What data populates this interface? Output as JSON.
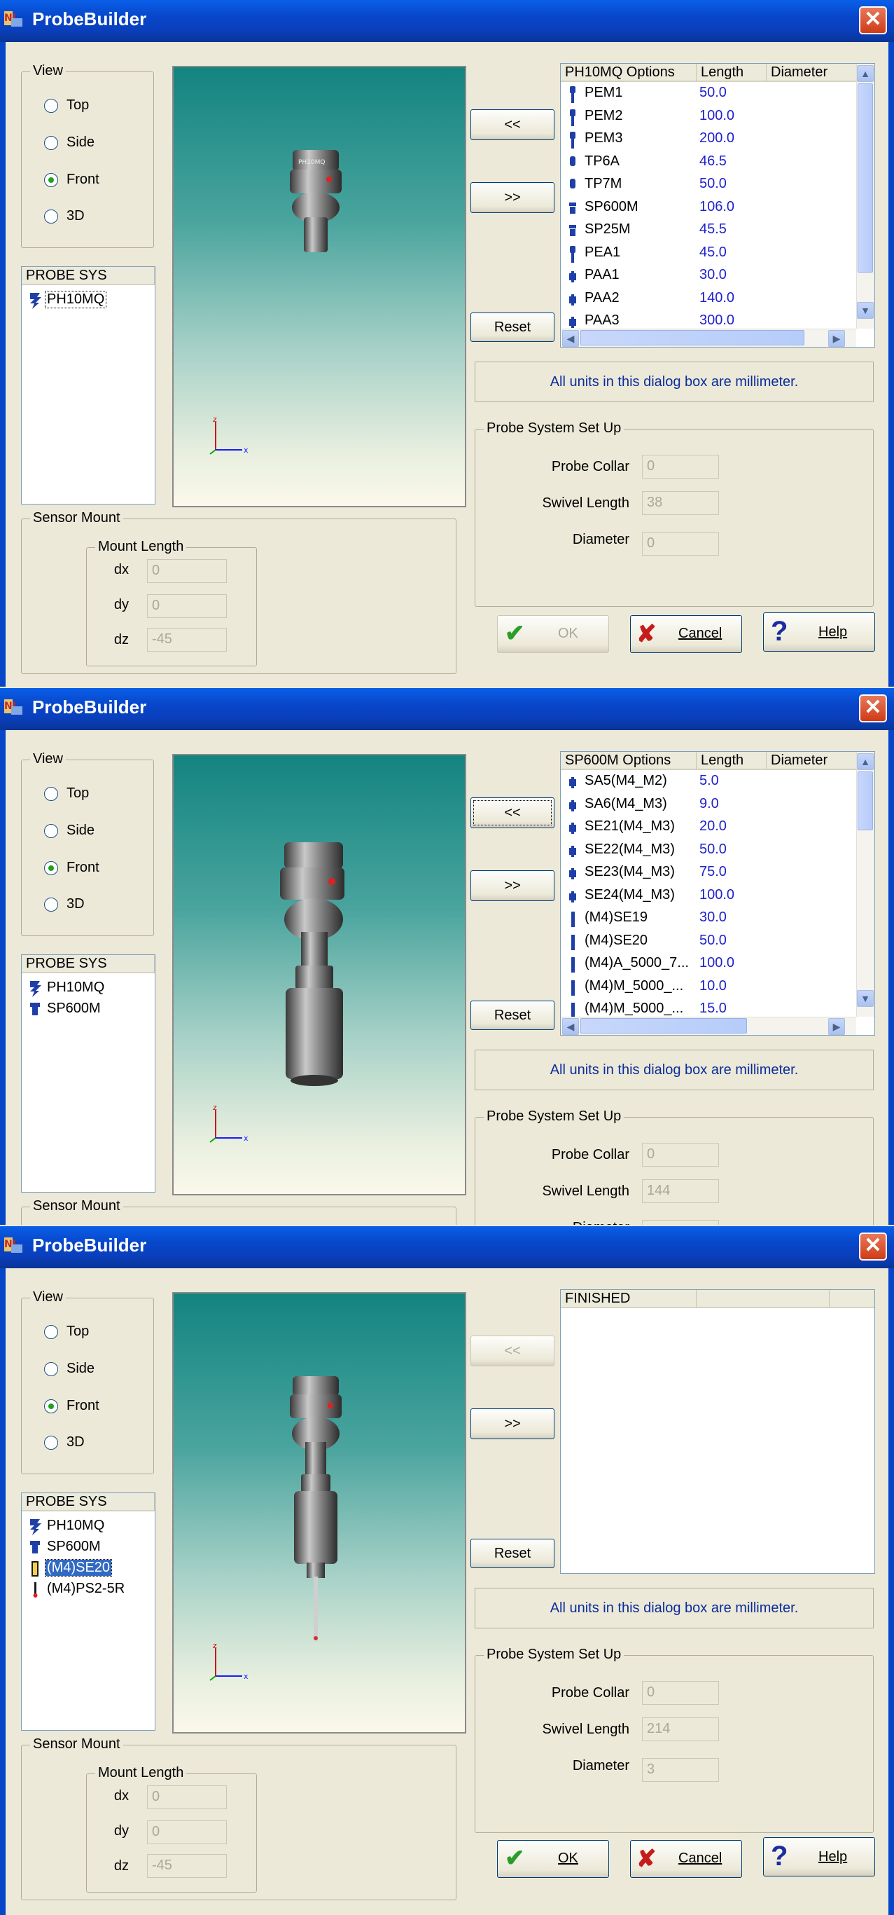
{
  "app": {
    "title": "ProbeBuilder",
    "close_glyph": "✕"
  },
  "colors": {
    "titlebar": "#0a46c8",
    "value_text": "#2020d0",
    "info_text": "#0b2d9b",
    "selection": "#316ac5"
  },
  "common": {
    "view_group": "View",
    "view_options": [
      "Top",
      "Side",
      "Front",
      "3D"
    ],
    "probe_sys_header": "PROBE SYS",
    "sensor_mount": "Sensor Mount",
    "mount_length": "Mount Length",
    "dx_label": "dx",
    "dy_label": "dy",
    "dz_label": "dz",
    "add_button": "<<",
    "remove_button": ">>",
    "reset_button": "Reset",
    "units_info": "All units in this dialog box are millimeter.",
    "setup_group": "Probe System Set Up",
    "probe_collar_label": "Probe Collar",
    "swivel_length_label": "Swivel Length",
    "diameter_label": "Diameter",
    "length_header": "Length",
    "diameter_header": "Diameter",
    "ok_label": "OK",
    "cancel_label": "Cancel",
    "help_label": "Help",
    "axis_x": "x",
    "axis_z": "z"
  },
  "windows": [
    {
      "selected_view": "Front",
      "probe_sys": [
        {
          "name": "PH10MQ",
          "icon": "ph10mq-icon"
        }
      ],
      "options_header": "PH10MQ Options",
      "options": [
        {
          "name": "PEM1",
          "length": "50.0",
          "icon": "extension-icon"
        },
        {
          "name": "PEM2",
          "length": "100.0",
          "icon": "extension-icon"
        },
        {
          "name": "PEM3",
          "length": "200.0",
          "icon": "extension-icon"
        },
        {
          "name": "TP6A",
          "length": "46.5",
          "icon": "probe-icon"
        },
        {
          "name": "TP7M",
          "length": "50.0",
          "icon": "probe-icon"
        },
        {
          "name": "SP600M",
          "length": "106.0",
          "icon": "probe-body-icon"
        },
        {
          "name": "SP25M",
          "length": "45.5",
          "icon": "probe-body-icon"
        },
        {
          "name": "PEA1",
          "length": "45.0",
          "icon": "extension-icon"
        },
        {
          "name": "PAA1",
          "length": "30.0",
          "icon": "adapter-icon"
        },
        {
          "name": "PAA2",
          "length": "140.0",
          "icon": "adapter-icon"
        },
        {
          "name": "PAA3",
          "length": "300.0",
          "icon": "adapter-icon"
        }
      ],
      "probe_collar": "0",
      "swivel_length": "38",
      "diameter": "0",
      "dx": "0",
      "dy": "0",
      "dz": "-45",
      "ok_enabled": false
    },
    {
      "selected_view": "Front",
      "probe_sys": [
        {
          "name": "PH10MQ",
          "icon": "ph10mq-icon"
        },
        {
          "name": "SP600M",
          "icon": "probe-body-icon"
        }
      ],
      "options_header": "SP600M Options",
      "options": [
        {
          "name": "SA5(M4_M2)",
          "length": "5.0",
          "icon": "adapter-icon"
        },
        {
          "name": "SA6(M4_M3)",
          "length": "9.0",
          "icon": "adapter-icon"
        },
        {
          "name": "SE21(M4_M3)",
          "length": "20.0",
          "icon": "adapter-icon"
        },
        {
          "name": "SE22(M4_M3)",
          "length": "50.0",
          "icon": "adapter-icon"
        },
        {
          "name": "SE23(M4_M3)",
          "length": "75.0",
          "icon": "adapter-icon"
        },
        {
          "name": "SE24(M4_M3)",
          "length": "100.0",
          "icon": "adapter-icon"
        },
        {
          "name": "(M4)SE19",
          "length": "30.0",
          "icon": "stylus-icon"
        },
        {
          "name": "(M4)SE20",
          "length": "50.0",
          "icon": "stylus-icon"
        },
        {
          "name": "(M4)A_5000_7...",
          "length": "100.0",
          "icon": "stylus-icon"
        },
        {
          "name": "(M4)M_5000_...",
          "length": "10.0",
          "icon": "stylus-icon"
        },
        {
          "name": "(M4)M_5000_...",
          "length": "15.0",
          "icon": "stylus-icon"
        }
      ],
      "probe_collar": "0",
      "swivel_length": "144"
    },
    {
      "selected_view": "Front",
      "probe_sys": [
        {
          "name": "PH10MQ",
          "icon": "ph10mq-icon"
        },
        {
          "name": "SP600M",
          "icon": "probe-body-icon"
        },
        {
          "name": "(M4)SE20",
          "icon": "extension-icon"
        },
        {
          "name": "(M4)PS2-5R",
          "icon": "stylus-tip-icon"
        }
      ],
      "options_header": "FINISHED",
      "options": [],
      "probe_collar": "0",
      "swivel_length": "214",
      "diameter": "3",
      "dx": "0",
      "dy": "0",
      "dz": "-45",
      "ok_enabled": true
    }
  ]
}
